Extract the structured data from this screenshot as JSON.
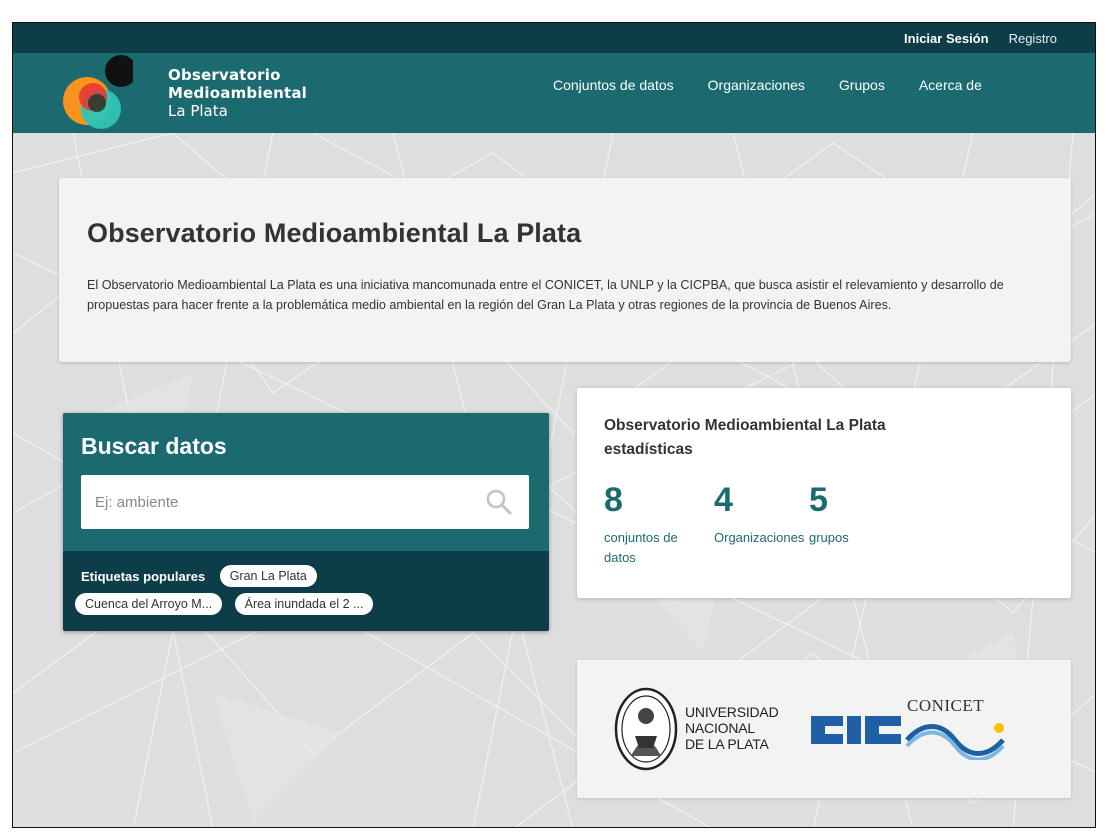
{
  "account": {
    "login": "Iniciar Sesión",
    "register": "Registro"
  },
  "brand": {
    "line1": "Observatorio",
    "line2": "Medioambiental",
    "line3": "La Plata"
  },
  "nav": {
    "items": [
      {
        "label": "Conjuntos de datos"
      },
      {
        "label": "Organizaciones"
      },
      {
        "label": "Grupos"
      },
      {
        "label": "Acerca de"
      }
    ]
  },
  "hero": {
    "title": "Observatorio Medioambiental La Plata",
    "description": "El Observatorio Medioambiental La Plata es una iniciativa mancomunada entre el CONICET, la UNLP y la CICPBA, que busca asistir el relevamiento y desarrollo de propuestas para hacer frente a la problemática medio ambiental en la región del Gran La Plata y otras regiones de la provincia de Buenos Aires."
  },
  "search": {
    "title": "Buscar datos",
    "placeholder": "Ej: ambiente",
    "tags_label": "Etiquetas populares",
    "tags": [
      "Gran La Plata",
      "Cuenca del Arroyo M...",
      "Área inundada el 2 ..."
    ]
  },
  "stats": {
    "title_line1": "Observatorio Medioambiental La Plata",
    "title_line2": "estadísticas",
    "items": [
      {
        "value": "8",
        "label": "conjuntos de datos"
      },
      {
        "value": "4",
        "label": "Organizaciones"
      },
      {
        "value": "5",
        "label": "grupos"
      }
    ]
  },
  "logos": {
    "unlp": [
      "UNIVERSIDAD",
      "NACIONAL",
      "DE LA PLATA"
    ],
    "conicet": "CONICET"
  },
  "colors": {
    "account_bar": "#0d3d48",
    "masthead": "#1b6a6f",
    "accent_text": "#1b6a6f",
    "logo_orange": "#f7941d",
    "logo_teal": "#2ec4b6",
    "logo_red": "#e53935",
    "logo_black": "#111111"
  },
  "icons": {
    "search": "search-icon"
  }
}
